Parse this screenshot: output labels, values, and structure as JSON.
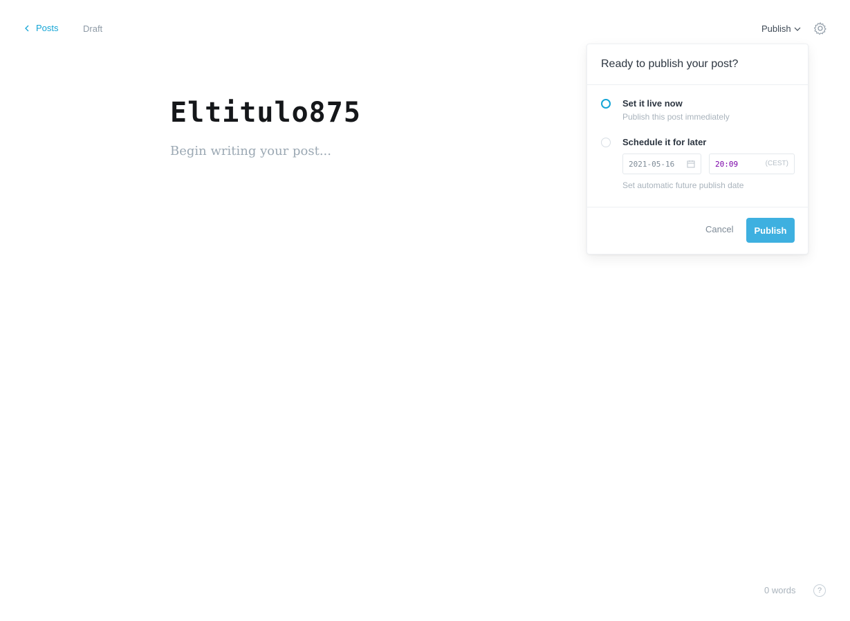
{
  "nav": {
    "back_label": "Posts",
    "status": "Draft"
  },
  "header": {
    "publish_menu_label": "Publish",
    "settings_icon": "gear-icon"
  },
  "editor": {
    "title": "Eltitulo875",
    "body_placeholder": "Begin writing your post..."
  },
  "publish_panel": {
    "heading": "Ready to publish your post?",
    "options": [
      {
        "label": "Set it live now",
        "description": "Publish this post immediately",
        "selected": true
      },
      {
        "label": "Schedule it for later",
        "description": "",
        "selected": false
      }
    ],
    "schedule": {
      "date_value": "2021-05-16",
      "time_value": "20:09",
      "timezone": "(CEST)",
      "hint": "Set automatic future publish date"
    },
    "cancel_label": "Cancel",
    "publish_label": "Publish"
  },
  "footer": {
    "word_count": "0 words",
    "help_label": "?"
  },
  "colors": {
    "accent": "#14a5d6",
    "publish_button": "#3eb0e0"
  }
}
